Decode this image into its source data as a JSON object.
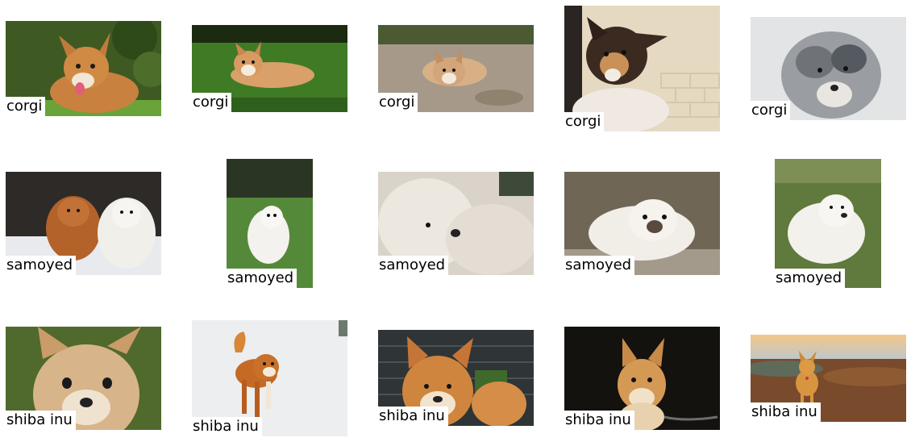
{
  "grid": {
    "rows": [
      {
        "breed": "corgi",
        "images": [
          {
            "label": "corgi",
            "scene": "corgi sitting on grass with tongue out, leafy background"
          },
          {
            "label": "corgi",
            "scene": "corgi puppy lying on green lawn"
          },
          {
            "label": "corgi",
            "scene": "corgi puppy lying on dirt ground"
          },
          {
            "label": "corgi",
            "scene": "tricolor corgi puppy held over a person's arm, brick wall"
          },
          {
            "label": "corgi",
            "scene": "blue merle puppy close-up, grey background"
          }
        ]
      },
      {
        "breed": "samoyed",
        "images": [
          {
            "label": "samoyed",
            "scene": "red and white fluffy dogs in snow"
          },
          {
            "label": "samoyed",
            "scene": "white samoyed puppy standing on grass"
          },
          {
            "label": "samoyed",
            "scene": "two white samoyeds close-up"
          },
          {
            "label": "samoyed",
            "scene": "white long-haired small dog lying on rock"
          },
          {
            "label": "samoyed",
            "scene": "white samoyed lying in grass"
          }
        ]
      },
      {
        "breed": "shiba inu",
        "images": [
          {
            "label": "shiba inu",
            "scene": "shiba inu face close-up, green background"
          },
          {
            "label": "shiba inu",
            "scene": "shiba inu walking in snow"
          },
          {
            "label": "shiba inu",
            "scene": "shiba inu in front of fence"
          },
          {
            "label": "shiba inu",
            "scene": "shiba inu on dark background with chain"
          },
          {
            "label": "shiba inu",
            "scene": "shiba inu standing on hill at sunset"
          }
        ]
      }
    ]
  },
  "colors": {
    "background": "#ffffff",
    "label_bg": "#ffffff",
    "label_text": "#000000"
  }
}
